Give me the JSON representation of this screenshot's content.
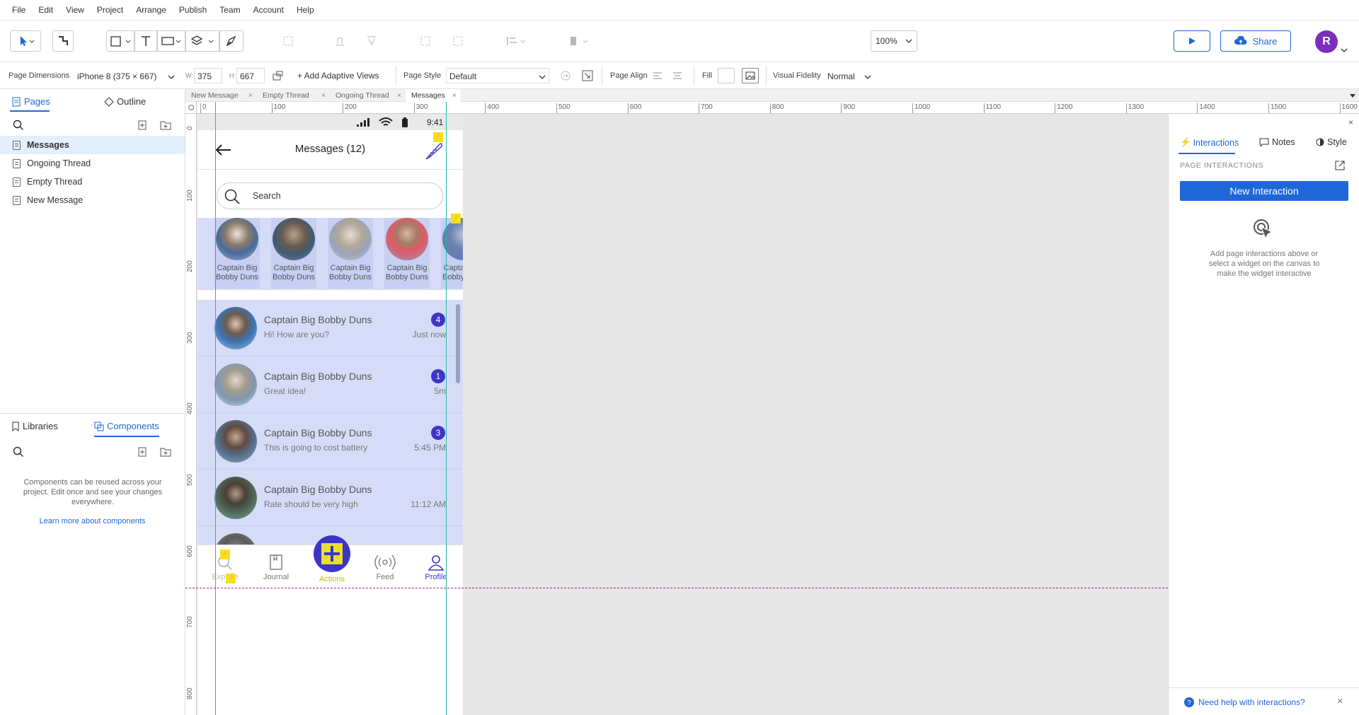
{
  "menu": [
    "File",
    "Edit",
    "View",
    "Project",
    "Arrange",
    "Publish",
    "Team",
    "Account",
    "Help"
  ],
  "toolbar": {
    "zoom": "100%",
    "share_label": "Share",
    "user_initial": "R"
  },
  "props": {
    "page_dimensions_label": "Page Dimensions",
    "device": "iPhone 8  (375 × 667)",
    "w_label": "W:",
    "w_value": "375",
    "h_label": "H:",
    "h_value": "667",
    "adaptive_label": "+ Add Adaptive Views",
    "page_style_label": "Page Style",
    "page_style_value": "Default",
    "page_align_label": "Page Align",
    "fill_label": "Fill",
    "visual_fidelity_label": "Visual Fidelity",
    "visual_fidelity_value": "Normal"
  },
  "left": {
    "tab_pages": "Pages",
    "tab_outline": "Outline",
    "pages": [
      "Messages",
      "Ongoing Thread",
      "Empty Thread",
      "New Message"
    ],
    "tab_libraries": "Libraries",
    "tab_components": "Components",
    "components_text": "Components can be reused across your project. Edit once and see your changes everywhere.",
    "components_link": "Learn more about components"
  },
  "tabs": [
    "New Message",
    "Empty Thread",
    "Ongoing Thread",
    "Messages"
  ],
  "ruler_h": [
    "0",
    "100",
    "200",
    "300",
    "400",
    "500",
    "600",
    "700",
    "800",
    "900",
    "1000",
    "1100",
    "1200",
    "1300",
    "1400",
    "1500",
    "1600"
  ],
  "ruler_v": [
    "0",
    "100",
    "200",
    "300",
    "400",
    "500",
    "600",
    "700",
    "800"
  ],
  "phone": {
    "time": "9:41",
    "title": "Messages (12)",
    "search_placeholder": "Search",
    "stories": [
      "Captain Big Bobby Duns",
      "Captain Big Bobby Duns",
      "Captain Big Bobby Duns",
      "Captain Big Bobby Duns",
      "Captain Big Bobby Duns"
    ],
    "messages": [
      {
        "name": "Captain Big Bobby Duns",
        "text": "Hi! How are you?",
        "count": "4",
        "time": "Just now"
      },
      {
        "name": "Captain Big Bobby Duns",
        "text": "Great idea!",
        "count": "1",
        "time": "5m"
      },
      {
        "name": "Captain Big Bobby Duns",
        "text": "This is going to cost battery",
        "count": "3",
        "time": "5:45 PM"
      },
      {
        "name": "Captain Big Bobby Duns",
        "text": "Rate should be very high",
        "count": "",
        "time": "11:12 AM"
      }
    ],
    "nav": [
      "Explore",
      "Journal",
      "Actions",
      "Feed",
      "Profile"
    ]
  },
  "right": {
    "tab_interactions": "Interactions",
    "tab_notes": "Notes",
    "tab_style": "Style",
    "section": "PAGE INTERACTIONS",
    "new_interaction": "New Interaction",
    "empty_text": "Add page interactions above or select a widget on the canvas to make the widget interactive",
    "help": "Need help with interactions?"
  },
  "colors": {
    "accent": "#1f67d8",
    "purple": "#3d35c9",
    "rowbg": "#d6dcf7",
    "avatar": "#7b2fbe",
    "yellow": "#f5e21b"
  }
}
